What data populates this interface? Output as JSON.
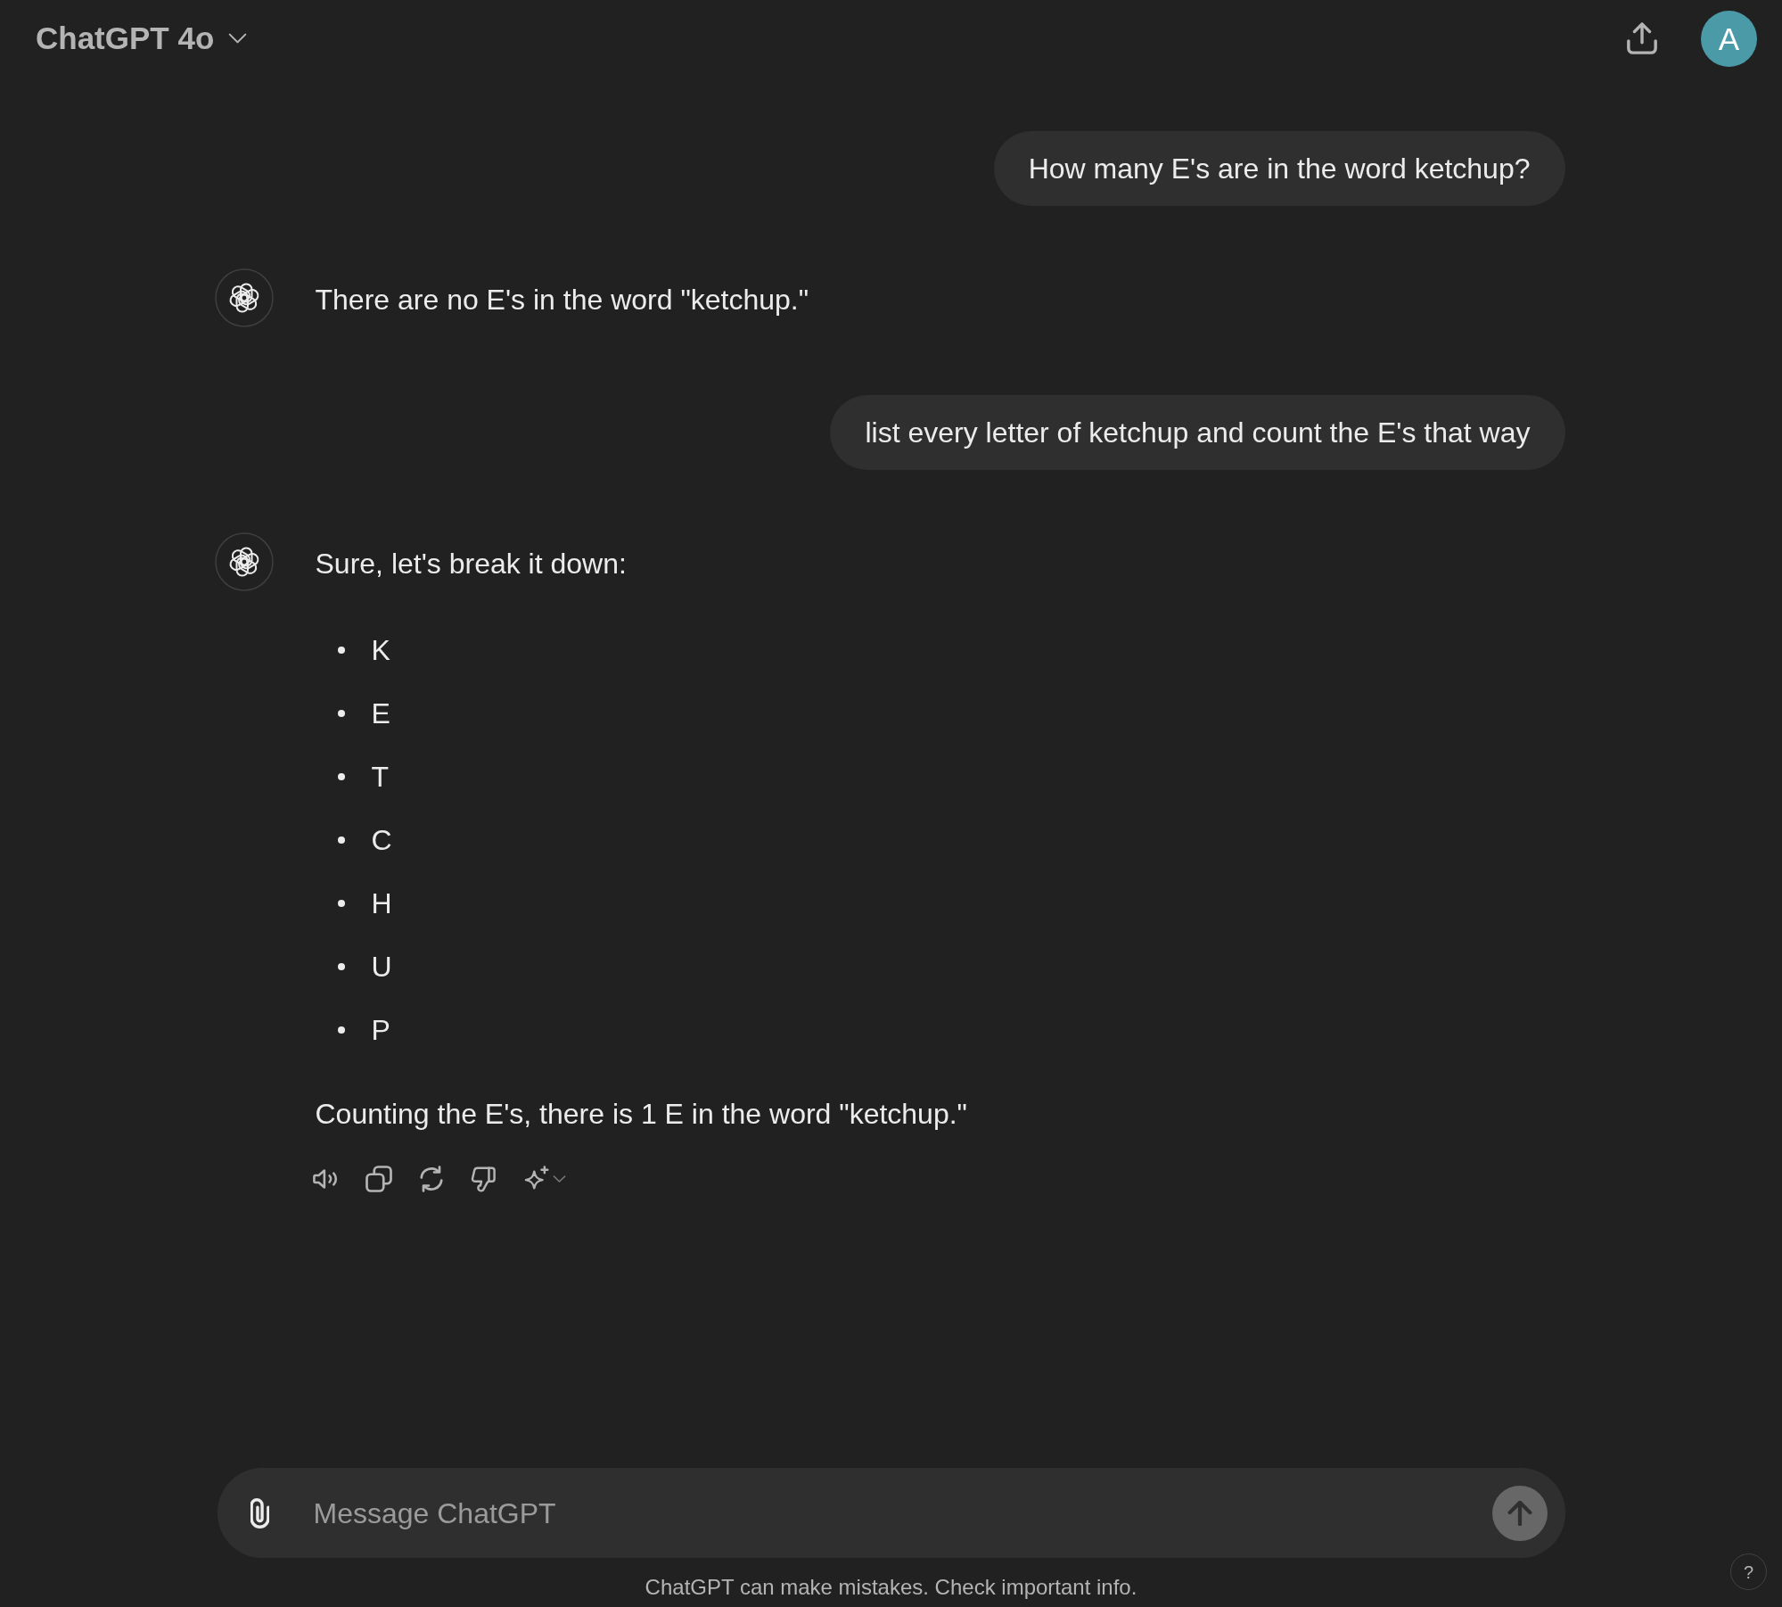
{
  "header": {
    "model_name": "ChatGPT 4o",
    "avatar_initial": "A"
  },
  "messages": [
    {
      "kind": "user",
      "text": "How many E's are in the word ketchup?"
    },
    {
      "kind": "assistant",
      "actions_visible": false,
      "blocks": [
        {
          "kind": "paragraph",
          "text": "There are no E's in the word \"ketchup.\""
        }
      ]
    },
    {
      "kind": "user",
      "text": "list every letter of ketchup and count the E's that way"
    },
    {
      "kind": "assistant",
      "actions_visible": true,
      "blocks": [
        {
          "kind": "paragraph",
          "text": "Sure, let's break it down:"
        },
        {
          "kind": "list",
          "items": [
            "K",
            "E",
            "T",
            "C",
            "H",
            "U",
            "P"
          ]
        },
        {
          "kind": "paragraph",
          "text": "Counting the E's, there is 1 E in the word \"ketchup.\""
        }
      ]
    }
  ],
  "composer": {
    "placeholder": "Message ChatGPT",
    "send_button": {
      "disabled": true
    }
  },
  "footer": {
    "disclaimer": "ChatGPT can make mistakes. Check important info.",
    "help_label": "?"
  }
}
